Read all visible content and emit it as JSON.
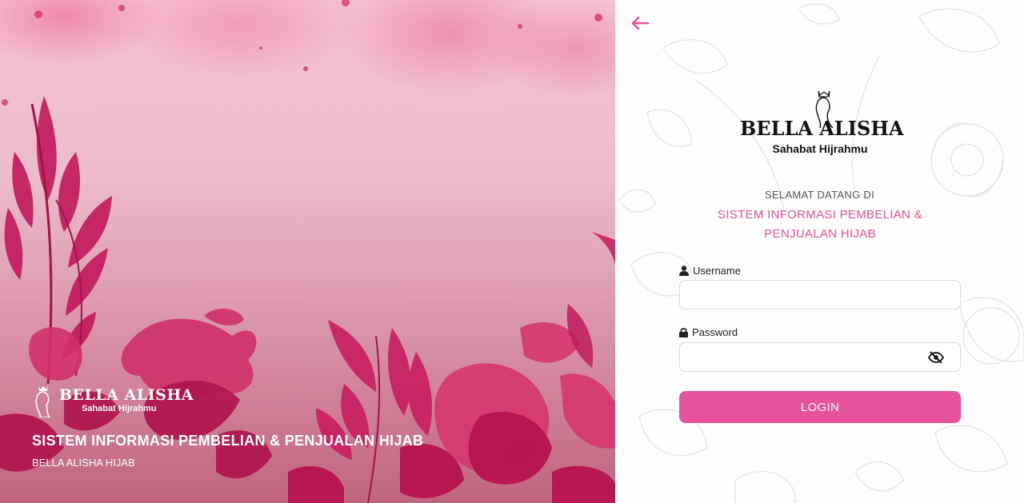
{
  "brand": {
    "name": "BELLA ALISHA",
    "logo_name": "BELLA ALISHA",
    "tagline": "Sahabat Hijrahmu"
  },
  "hero": {
    "title": "SISTEM INFORMASI PEMBELIAN & PENJUALAN HIJAB",
    "subtitle": "BELLA ALISHA HIJAB"
  },
  "login": {
    "welcome": "SELAMAT DATANG DI",
    "system_name": "SISTEM INFORMASI PEMBELIAN & PENJUALAN HIJAB",
    "username_label": "Username",
    "username_value": "",
    "password_label": "Password",
    "password_value": "",
    "submit_label": "LOGIN"
  },
  "icons": {
    "back": "arrow-left-icon",
    "user": "user-icon",
    "lock": "lock-icon",
    "toggle_password": "eye-slash-icon"
  },
  "colors": {
    "accent": "#e6529b",
    "accent_text": "#e0559a",
    "hero_base": "#c0647f"
  }
}
